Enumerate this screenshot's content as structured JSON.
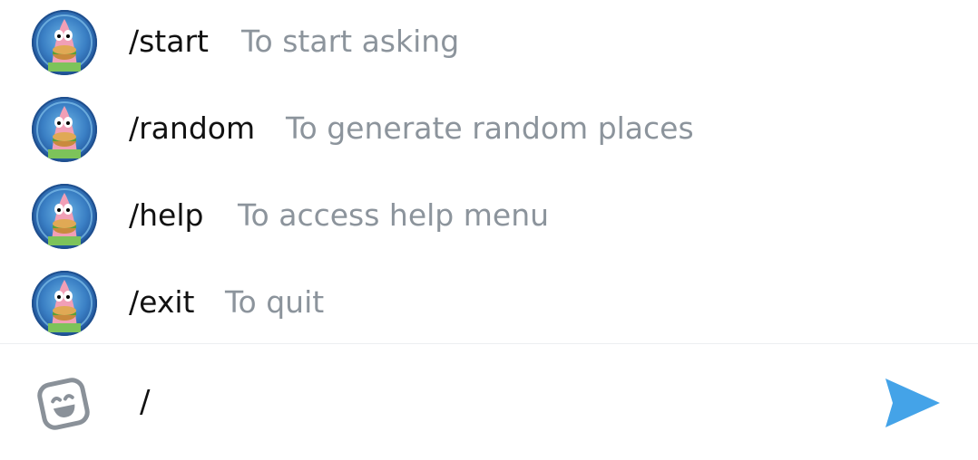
{
  "commands": [
    {
      "name": "/start",
      "description": "To start asking"
    },
    {
      "name": "/random",
      "description": "To generate random places"
    },
    {
      "name": "/help",
      "description": "To access help menu"
    },
    {
      "name": "/exit",
      "description": "To quit"
    }
  ],
  "input": {
    "value": "/",
    "placeholder": ""
  },
  "icons": {
    "emoji": "emoji-smile-icon",
    "send": "send-icon"
  },
  "colors": {
    "accent": "#44a3e8",
    "muted_text": "#8c949c",
    "text": "#111111"
  }
}
